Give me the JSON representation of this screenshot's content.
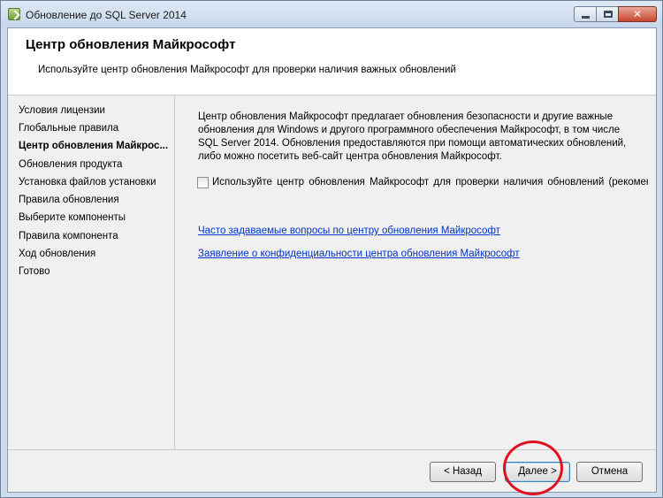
{
  "window": {
    "title": "Обновление до SQL Server 2014"
  },
  "header": {
    "title": "Центр обновления Майкрософт",
    "subtitle": "Используйте центр обновления Майкрософт для проверки наличия важных обновлений"
  },
  "sidebar": {
    "items": [
      {
        "label": "Условия лицензии",
        "active": false
      },
      {
        "label": "Глобальные правила",
        "active": false
      },
      {
        "label": "Центр обновления Майкрос...",
        "active": true
      },
      {
        "label": "Обновления продукта",
        "active": false
      },
      {
        "label": "Установка файлов установки",
        "active": false
      },
      {
        "label": "Правила обновления",
        "active": false
      },
      {
        "label": "Выберите компоненты",
        "active": false
      },
      {
        "label": "Правила компонента",
        "active": false
      },
      {
        "label": "Ход обновления",
        "active": false
      },
      {
        "label": "Готово",
        "active": false
      }
    ]
  },
  "main": {
    "description": "Центр обновления Майкрософт предлагает обновления безопасности и другие важные обновления для Windows и другого программного обеспечения Майкрософт, в том числе SQL Server 2014. Обновления предоставляются при помощи автоматических обновлений, либо можно посетить веб-сайт центра обновления Майкрософт.",
    "checkbox_label": "Используйте центр обновления Майкрософт для проверки наличия обновлений (рекоменду",
    "checkbox_checked": false,
    "links": [
      "Часто задаваемые вопросы по центру обновления Майкрософт",
      "Заявление о конфиденциальности центра обновления Майкрософт"
    ]
  },
  "footer": {
    "back_label": "< Назад",
    "next_label": "Далее >",
    "cancel_label": "Отмена"
  },
  "colors": {
    "link": "#0033cc",
    "highlight_circle": "#e01020"
  }
}
